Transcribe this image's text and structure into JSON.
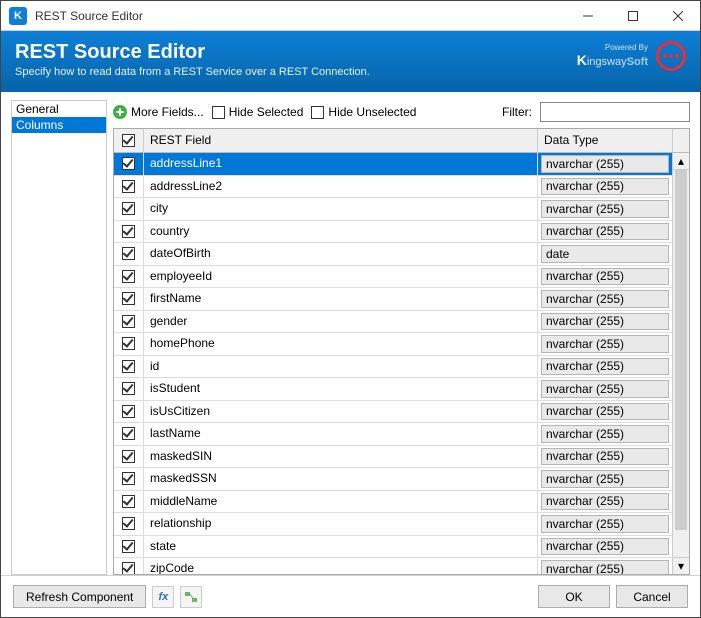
{
  "window": {
    "title": "REST Source Editor"
  },
  "header": {
    "title": "REST Source Editor",
    "subtitle": "Specify how to read data from a REST Service over a REST Connection.",
    "powered_by": "Powered By",
    "brand_k": "K",
    "brand_rest": "ingsway",
    "brand_soft": "Soft"
  },
  "sidebar": {
    "items": [
      {
        "label": "General",
        "selected": false
      },
      {
        "label": "Columns",
        "selected": true
      }
    ]
  },
  "toolbar": {
    "more_fields": "More Fields...",
    "hide_selected": "Hide Selected",
    "hide_unselected": "Hide Unselected",
    "filter_label": "Filter:",
    "filter_value": ""
  },
  "grid": {
    "col_field": "REST Field",
    "col_type": "Data Type",
    "rows": [
      {
        "field": "addressLine1",
        "type": "nvarchar (255)",
        "checked": true,
        "selected": true
      },
      {
        "field": "addressLine2",
        "type": "nvarchar (255)",
        "checked": true,
        "selected": false
      },
      {
        "field": "city",
        "type": "nvarchar (255)",
        "checked": true,
        "selected": false
      },
      {
        "field": "country",
        "type": "nvarchar (255)",
        "checked": true,
        "selected": false
      },
      {
        "field": "dateOfBirth",
        "type": "date",
        "checked": true,
        "selected": false
      },
      {
        "field": "employeeId",
        "type": "nvarchar (255)",
        "checked": true,
        "selected": false
      },
      {
        "field": "firstName",
        "type": "nvarchar (255)",
        "checked": true,
        "selected": false
      },
      {
        "field": "gender",
        "type": "nvarchar (255)",
        "checked": true,
        "selected": false
      },
      {
        "field": "homePhone",
        "type": "nvarchar (255)",
        "checked": true,
        "selected": false
      },
      {
        "field": "id",
        "type": "nvarchar (255)",
        "checked": true,
        "selected": false
      },
      {
        "field": "isStudent",
        "type": "nvarchar (255)",
        "checked": true,
        "selected": false
      },
      {
        "field": "isUsCitizen",
        "type": "nvarchar (255)",
        "checked": true,
        "selected": false
      },
      {
        "field": "lastName",
        "type": "nvarchar (255)",
        "checked": true,
        "selected": false
      },
      {
        "field": "maskedSIN",
        "type": "nvarchar (255)",
        "checked": true,
        "selected": false
      },
      {
        "field": "maskedSSN",
        "type": "nvarchar (255)",
        "checked": true,
        "selected": false
      },
      {
        "field": "middleName",
        "type": "nvarchar (255)",
        "checked": true,
        "selected": false
      },
      {
        "field": "relationship",
        "type": "nvarchar (255)",
        "checked": true,
        "selected": false
      },
      {
        "field": "state",
        "type": "nvarchar (255)",
        "checked": true,
        "selected": false
      },
      {
        "field": "zipCode",
        "type": "nvarchar (255)",
        "checked": true,
        "selected": false
      }
    ]
  },
  "footer": {
    "refresh": "Refresh Component",
    "ok": "OK",
    "cancel": "Cancel"
  }
}
